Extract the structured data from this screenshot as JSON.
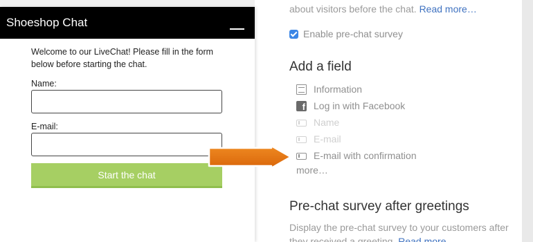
{
  "settings": {
    "top_description": "about visitors before the chat.",
    "top_link": "Read more…",
    "enable_label": "Enable pre-chat survey",
    "add_field_title": "Add a field",
    "fields": [
      {
        "label": "Information",
        "icon": "document-icon",
        "enabled": true
      },
      {
        "label": "Log in with Facebook",
        "icon": "facebook-icon",
        "enabled": true
      },
      {
        "label": "Name",
        "icon": "input-field-icon",
        "enabled": false
      },
      {
        "label": "E-mail",
        "icon": "input-field-icon",
        "enabled": false
      },
      {
        "label": "E-mail with confirmation",
        "icon": "input-field-icon",
        "enabled": true
      }
    ],
    "more_label": "more…",
    "greetings_title": "Pre-chat survey after greetings",
    "greetings_description": "Display the pre-chat survey to your customers after they received a greeting.",
    "greetings_link": "Read more…"
  },
  "chat": {
    "title": "Shoeshop Chat",
    "welcome": "Welcome to our LiveChat! Please fill in the form below before starting the chat.",
    "name_label": "Name:",
    "name_value": "",
    "email_label": "E-mail:",
    "email_value": "",
    "start_button": "Start the chat"
  },
  "colors": {
    "header_bg": "#000000",
    "start_button": "#a6cf63",
    "link": "#3f72c0",
    "checkbox": "#3b86e6",
    "arrow": "#e2720e"
  }
}
